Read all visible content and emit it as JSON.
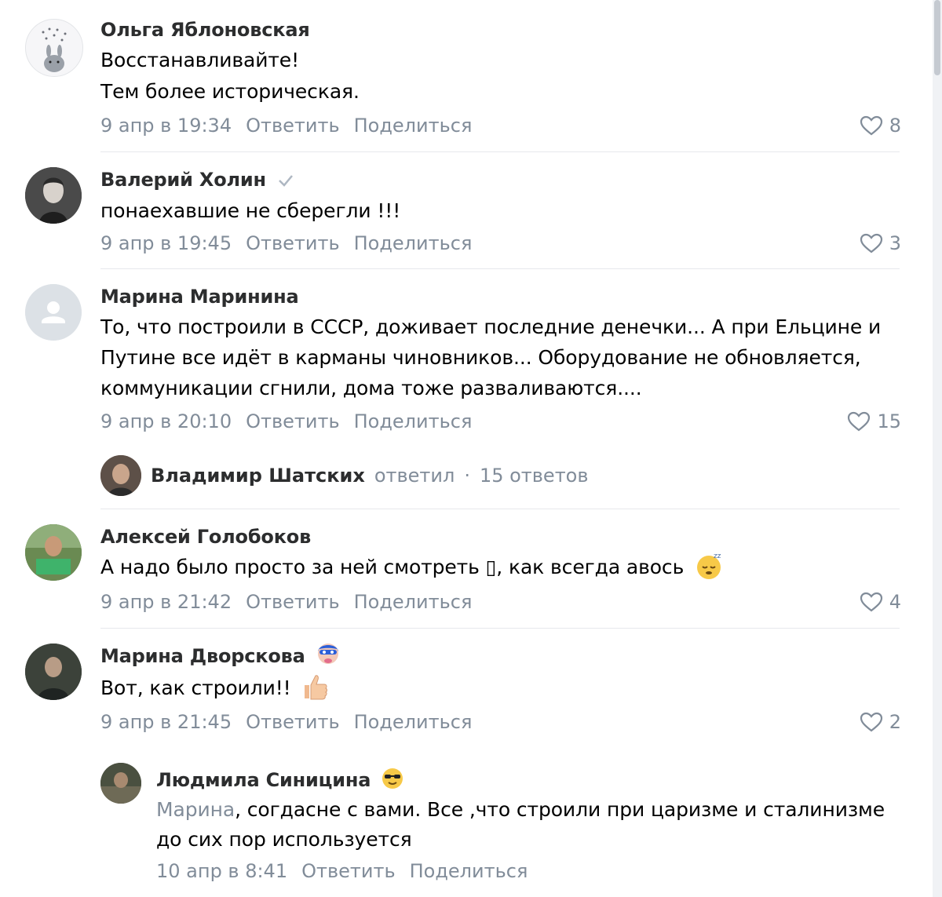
{
  "colors": {
    "name": "#2c2d2e",
    "meta": "#818c99",
    "divider": "#e7e8ec"
  },
  "comments": [
    {
      "name": "Ольга Яблоновская",
      "lines": [
        "Восстанавливайте!",
        "Тем более историческая."
      ],
      "date": "9 апр в 19:34",
      "reply": "Ответить",
      "share": "Поделиться",
      "likes": "8"
    },
    {
      "name": "Валерий Холин",
      "verified_icon": "check-icon",
      "lines": [
        "понаехавшие не сберегли !!!"
      ],
      "date": "9 апр в 19:45",
      "reply": "Ответить",
      "share": "Поделиться",
      "likes": "3"
    },
    {
      "name": "Марина Маринина",
      "lines": [
        "То, что построили в СССР, доживает последние денечки... А при Ельцине и",
        "Путине все идёт в карманы чиновников... Оборудование не обновляется,",
        "коммуникации сгнили, дома тоже разваливаются...."
      ],
      "date": "9 апр в 20:10",
      "reply": "Ответить",
      "share": "Поделиться",
      "likes": "15",
      "replies_summary": {
        "name": "Владимир Шатских",
        "action": "ответил",
        "dot": "·",
        "count": "15 ответов"
      }
    },
    {
      "name": "Алексей Голобоков",
      "lines": [
        "А надо было просто за ней смотреть ▯, как всегда авось"
      ],
      "emoji": "sleeping-face-icon",
      "date": "9 апр в 21:42",
      "reply": "Ответить",
      "share": "Поделиться",
      "likes": "4"
    },
    {
      "name": "Марина Дворскова",
      "name_emoji": "superhero-icon",
      "lines": [
        "Вот, как строили!!"
      ],
      "emoji": "thumbs-up-icon",
      "date": "9 апр в 21:45",
      "reply": "Ответить",
      "share": "Поделиться",
      "likes": "2"
    }
  ],
  "nested_reply": {
    "name": "Людмила Синицина",
    "name_emoji": "sunglasses-face-icon",
    "mention": "Марина",
    "line1_rest": ", согдасне с вами. Все ,что строили при царизме и сталинизме",
    "line2": "до сих пор используется",
    "date": "10 апр в 8:41",
    "reply": "Ответить",
    "share": "Поделиться"
  }
}
